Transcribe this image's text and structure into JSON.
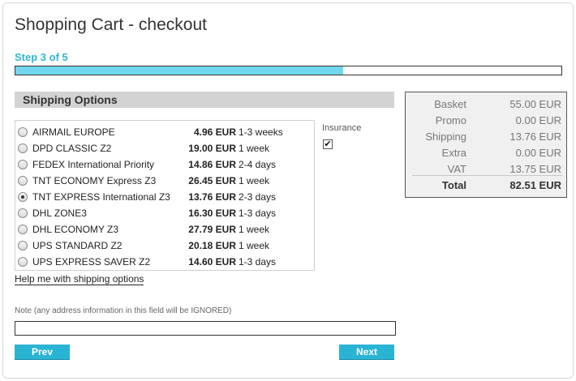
{
  "page": {
    "title": "Shopping Cart - checkout",
    "step_label": "Step 3 of 5",
    "progress_fraction": 0.6
  },
  "shipping": {
    "header": "Shipping Options",
    "options": [
      {
        "name": "AIRMAIL EUROPE",
        "price": "4.96 EUR",
        "time": "1-3 weeks",
        "selected": false
      },
      {
        "name": "DPD CLASSIC Z2",
        "price": "19.00 EUR",
        "time": "1 week",
        "selected": false
      },
      {
        "name": "FEDEX International Priority",
        "price": "14.86 EUR",
        "time": "2-4 days",
        "selected": false
      },
      {
        "name": "TNT ECONOMY Express Z3",
        "price": "26.45 EUR",
        "time": "1 week",
        "selected": false
      },
      {
        "name": "TNT EXPRESS International Z3",
        "price": "13.76 EUR",
        "time": "2-3 days",
        "selected": true
      },
      {
        "name": "DHL ZONE3",
        "price": "16.30 EUR",
        "time": "1-3 days",
        "selected": false
      },
      {
        "name": "DHL ECONOMY Z3",
        "price": "27.79 EUR",
        "time": "1 week",
        "selected": false
      },
      {
        "name": "UPS STANDARD Z2",
        "price": "20.18 EUR",
        "time": "1 week",
        "selected": false
      },
      {
        "name": "UPS EXPRESS SAVER Z2",
        "price": "14.60 EUR",
        "time": "1-3 days",
        "selected": false
      }
    ],
    "insurance_label": "Insurance",
    "insurance_checked": true,
    "help_link": "Help me with shipping options"
  },
  "summary": {
    "rows": [
      {
        "label": "Basket",
        "value": "55.00 EUR"
      },
      {
        "label": "Promo",
        "value": "0.00 EUR"
      },
      {
        "label": "Shipping",
        "value": "13.76 EUR"
      },
      {
        "label": "Extra",
        "value": "0.00 EUR"
      },
      {
        "label": "VAT",
        "value": "13.75 EUR"
      }
    ],
    "total_label": "Total",
    "total_value": "82.51 EUR"
  },
  "note": {
    "label": "Note (any address information in this field will be IGNORED)",
    "value": ""
  },
  "buttons": {
    "prev": "Prev",
    "next": "Next"
  },
  "colors": {
    "accent": "#2ab4d4",
    "step_text": "#2fb6d6",
    "progress_fill": "#72d7ee",
    "section_header_bg": "#d3d3d3",
    "summary_bg": "#f0f0f0"
  },
  "icons": {
    "insurance_check": "checkmark-icon"
  }
}
